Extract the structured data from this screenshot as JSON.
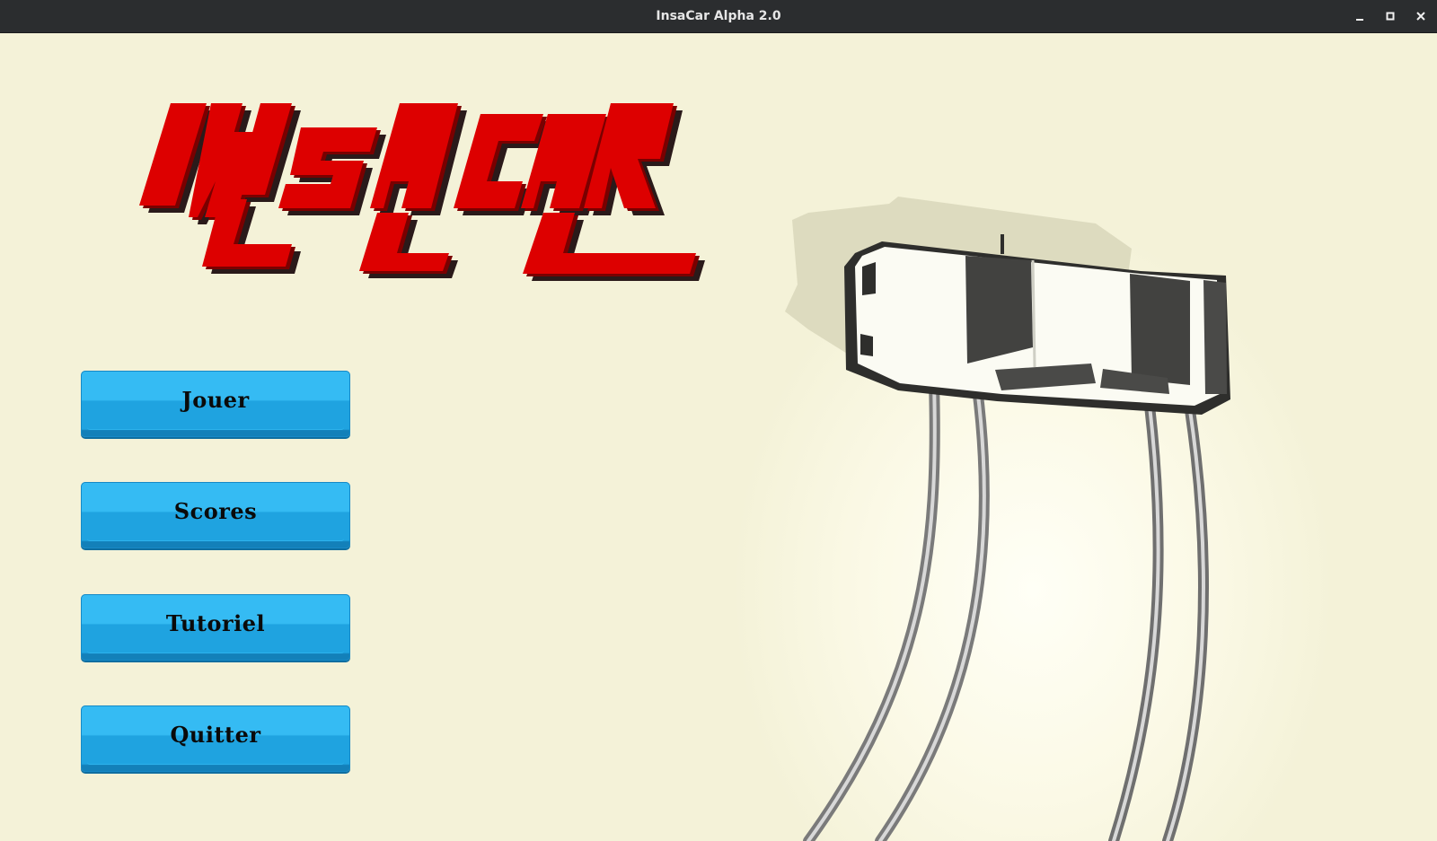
{
  "window": {
    "title": "InsaCar Alpha 2.0",
    "controls": {
      "minimize_icon": "minimize-icon",
      "maximize_icon": "maximize-icon",
      "close_icon": "close-icon"
    }
  },
  "logo": {
    "text": "INSACAR",
    "color": "#dd0000"
  },
  "menu": {
    "play_label": "Jouer",
    "scores_label": "Scores",
    "tutorial_label": "Tutoriel",
    "quit_label": "Quitter",
    "button_color": "#35bbf3"
  },
  "colors": {
    "background": "#f4f2d8",
    "titlebar": "#2b2d2f"
  }
}
